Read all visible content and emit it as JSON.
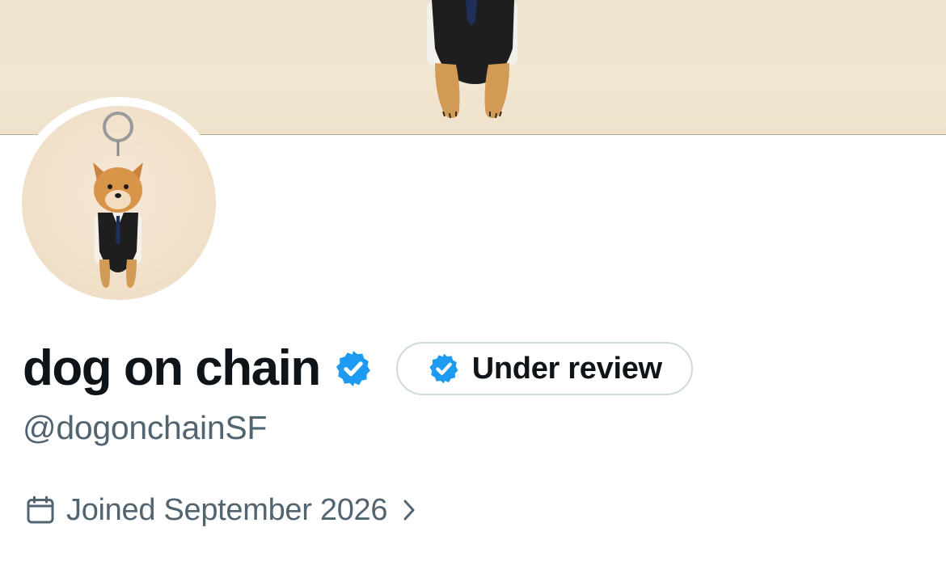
{
  "colors": {
    "text_primary": "#0f1419",
    "text_secondary": "#536471",
    "verified_blue": "#1d9bf0",
    "pill_border": "#cfd9de",
    "banner_bg": "#efe3cd"
  },
  "banner": {
    "image": "dog-figure-banner-image"
  },
  "profile": {
    "avatar_image": "shiba-keychain-avatar",
    "display_name": "dog on chain",
    "verified_icon": "verified-badge-icon",
    "review_badge": {
      "icon": "verified-badge-icon",
      "label": "Under review"
    },
    "handle": "@dogonchainSF",
    "joined": {
      "icon": "calendar-icon",
      "text": "Joined September 2026",
      "chevron": "chevron-right-icon"
    }
  }
}
